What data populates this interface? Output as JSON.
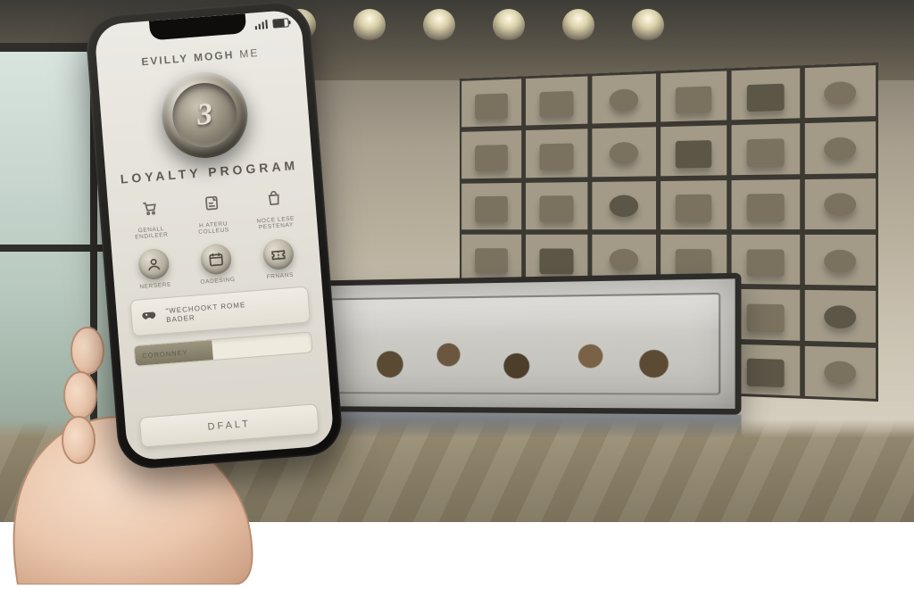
{
  "statusbar": {
    "time": ""
  },
  "brand": {
    "word1": "EVILLY",
    "word2": "MOGH",
    "word3": "ME"
  },
  "medal": {
    "value": "3"
  },
  "program_label": "LOYALTY PROGRAM",
  "row1": [
    {
      "icon": "cart-icon",
      "label": "GENALL ENDILEER"
    },
    {
      "icon": "note-icon",
      "label": "H ATERU COLLEUS"
    },
    {
      "icon": "bag-icon",
      "label": "NOCE LESE PESTENAY"
    }
  ],
  "row2": [
    {
      "icon": "person-icon",
      "label": "NERSERE"
    },
    {
      "icon": "calendar-icon",
      "label": "OADESING"
    },
    {
      "icon": "ticket-icon",
      "label": "FRNANS"
    }
  ],
  "banner": {
    "icon": "controller-icon",
    "line1": "\"WECHOOKT ROME",
    "line2": "BADER"
  },
  "progress": {
    "label": "CORONNEY",
    "percent": 44
  },
  "cta": {
    "label": "DFALT"
  },
  "colors": {
    "accent": "#8c8677",
    "text": "#5f5b53",
    "screen_bg": "#e4e1d9"
  }
}
